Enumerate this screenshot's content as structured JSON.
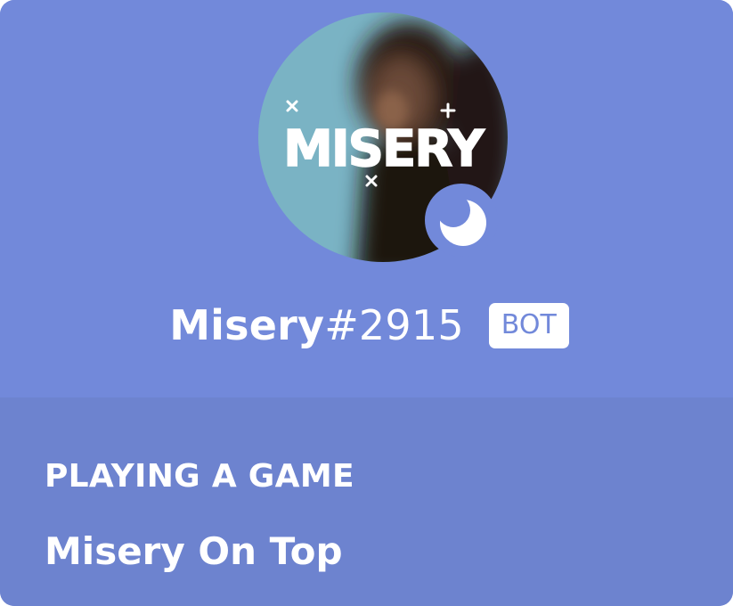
{
  "user": {
    "avatar_text": "MISERY",
    "name": "Misery",
    "discriminator": "#2915",
    "tag": "BOT",
    "status": "idle"
  },
  "activity": {
    "header": "PLAYING A GAME",
    "name": "Misery On Top"
  },
  "colors": {
    "blurple": "#7289da",
    "blurple_dark": "#6d83cf",
    "white": "#ffffff",
    "avatar_bg": "#7ab3c4"
  }
}
